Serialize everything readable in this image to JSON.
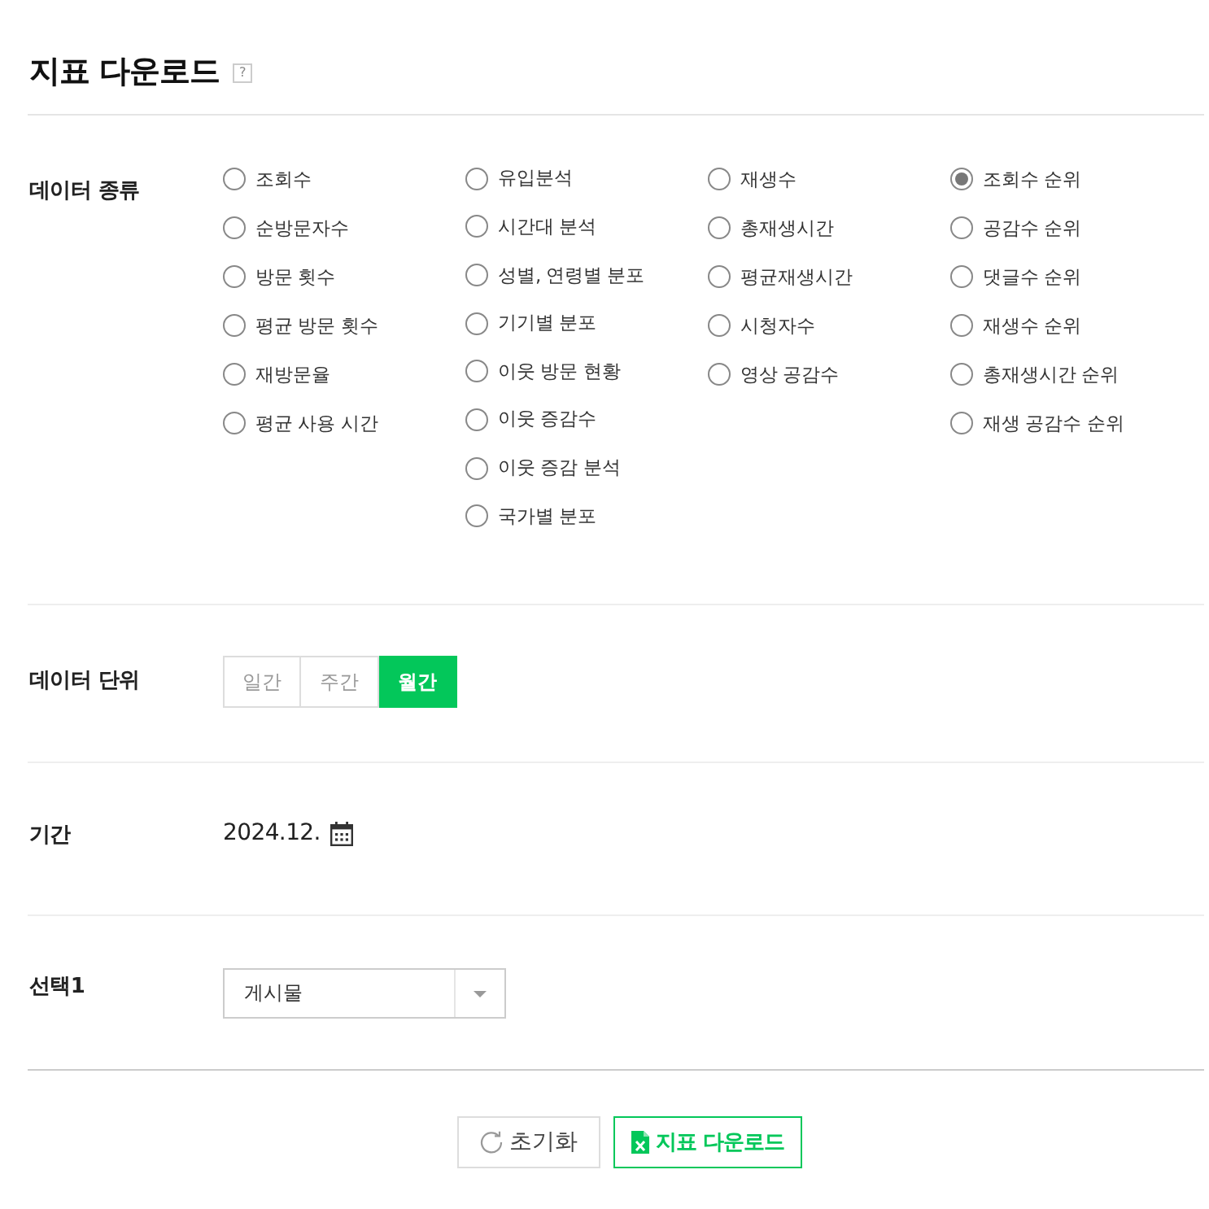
{
  "title": "지표 다운로드",
  "help": "?",
  "data_type": {
    "label": "데이터 종류",
    "columns": [
      [
        {
          "label": "조회수",
          "selected": false
        },
        {
          "label": "순방문자수",
          "selected": false
        },
        {
          "label": "방문 횟수",
          "selected": false
        },
        {
          "label": "평균 방문 횟수",
          "selected": false
        },
        {
          "label": "재방문율",
          "selected": false
        },
        {
          "label": "평균 사용 시간",
          "selected": false
        }
      ],
      [
        {
          "label": "유입분석",
          "selected": false
        },
        {
          "label": "시간대 분석",
          "selected": false
        },
        {
          "label": "성별, 연령별 분포",
          "selected": false
        },
        {
          "label": "기기별 분포",
          "selected": false
        },
        {
          "label": "이웃 방문 현황",
          "selected": false
        },
        {
          "label": "이웃 증감수",
          "selected": false
        },
        {
          "label": "이웃 증감 분석",
          "selected": false
        },
        {
          "label": "국가별 분포",
          "selected": false
        }
      ],
      [
        {
          "label": "재생수",
          "selected": false
        },
        {
          "label": "총재생시간",
          "selected": false
        },
        {
          "label": "평균재생시간",
          "selected": false
        },
        {
          "label": "시청자수",
          "selected": false
        },
        {
          "label": "영상 공감수",
          "selected": false
        }
      ],
      [
        {
          "label": "조회수 순위",
          "selected": true
        },
        {
          "label": "공감수 순위",
          "selected": false
        },
        {
          "label": "댓글수 순위",
          "selected": false
        },
        {
          "label": "재생수 순위",
          "selected": false
        },
        {
          "label": "총재생시간 순위",
          "selected": false
        },
        {
          "label": "재생 공감수 순위",
          "selected": false
        }
      ]
    ]
  },
  "data_unit": {
    "label": "데이터 단위",
    "options": [
      {
        "label": "일간",
        "selected": false
      },
      {
        "label": "주간",
        "selected": false
      },
      {
        "label": "월간",
        "selected": true
      }
    ]
  },
  "period": {
    "label": "기간",
    "value": "2024.12."
  },
  "select1": {
    "label": "선택1",
    "value": "게시물"
  },
  "buttons": [
    {
      "kind": "reset",
      "label": "초기화"
    },
    {
      "kind": "download",
      "label": "지표 다운로드"
    }
  ]
}
